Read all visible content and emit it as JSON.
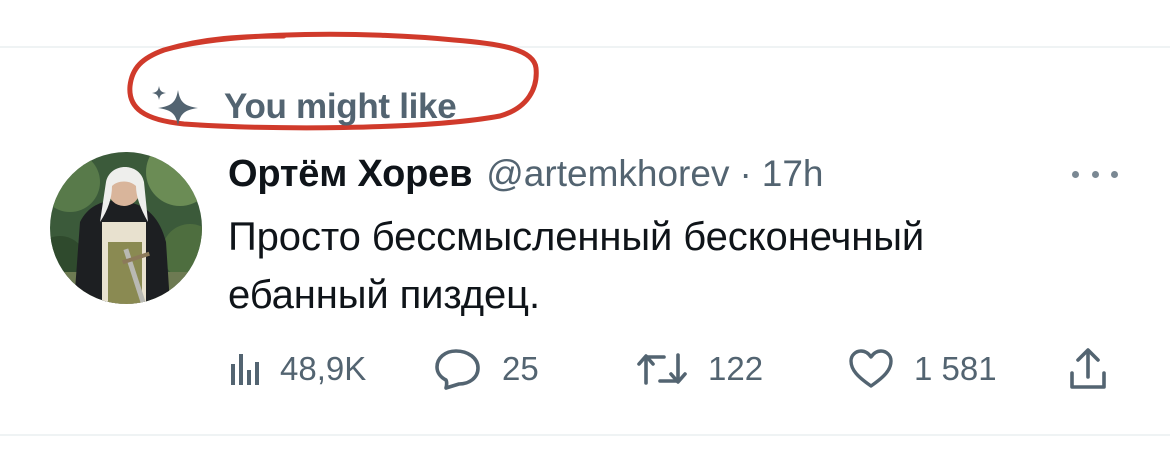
{
  "context": {
    "label": "You might like",
    "icon": "sparkle-icon"
  },
  "tweet": {
    "author": {
      "display_name": "Ортём Хорев",
      "handle": "@artemkhorev",
      "separator": "·",
      "time": "17h"
    },
    "text": "Просто бессмысленный бесконечный ебанный пиздец.",
    "actions": {
      "views": "48,9K",
      "replies": "25",
      "retweets": "122",
      "likes": "1 581"
    }
  },
  "colors": {
    "primary_text": "#0f1419",
    "secondary_text": "#536471",
    "divider": "#eff3f4",
    "annotation_red": "#d03a2b"
  }
}
